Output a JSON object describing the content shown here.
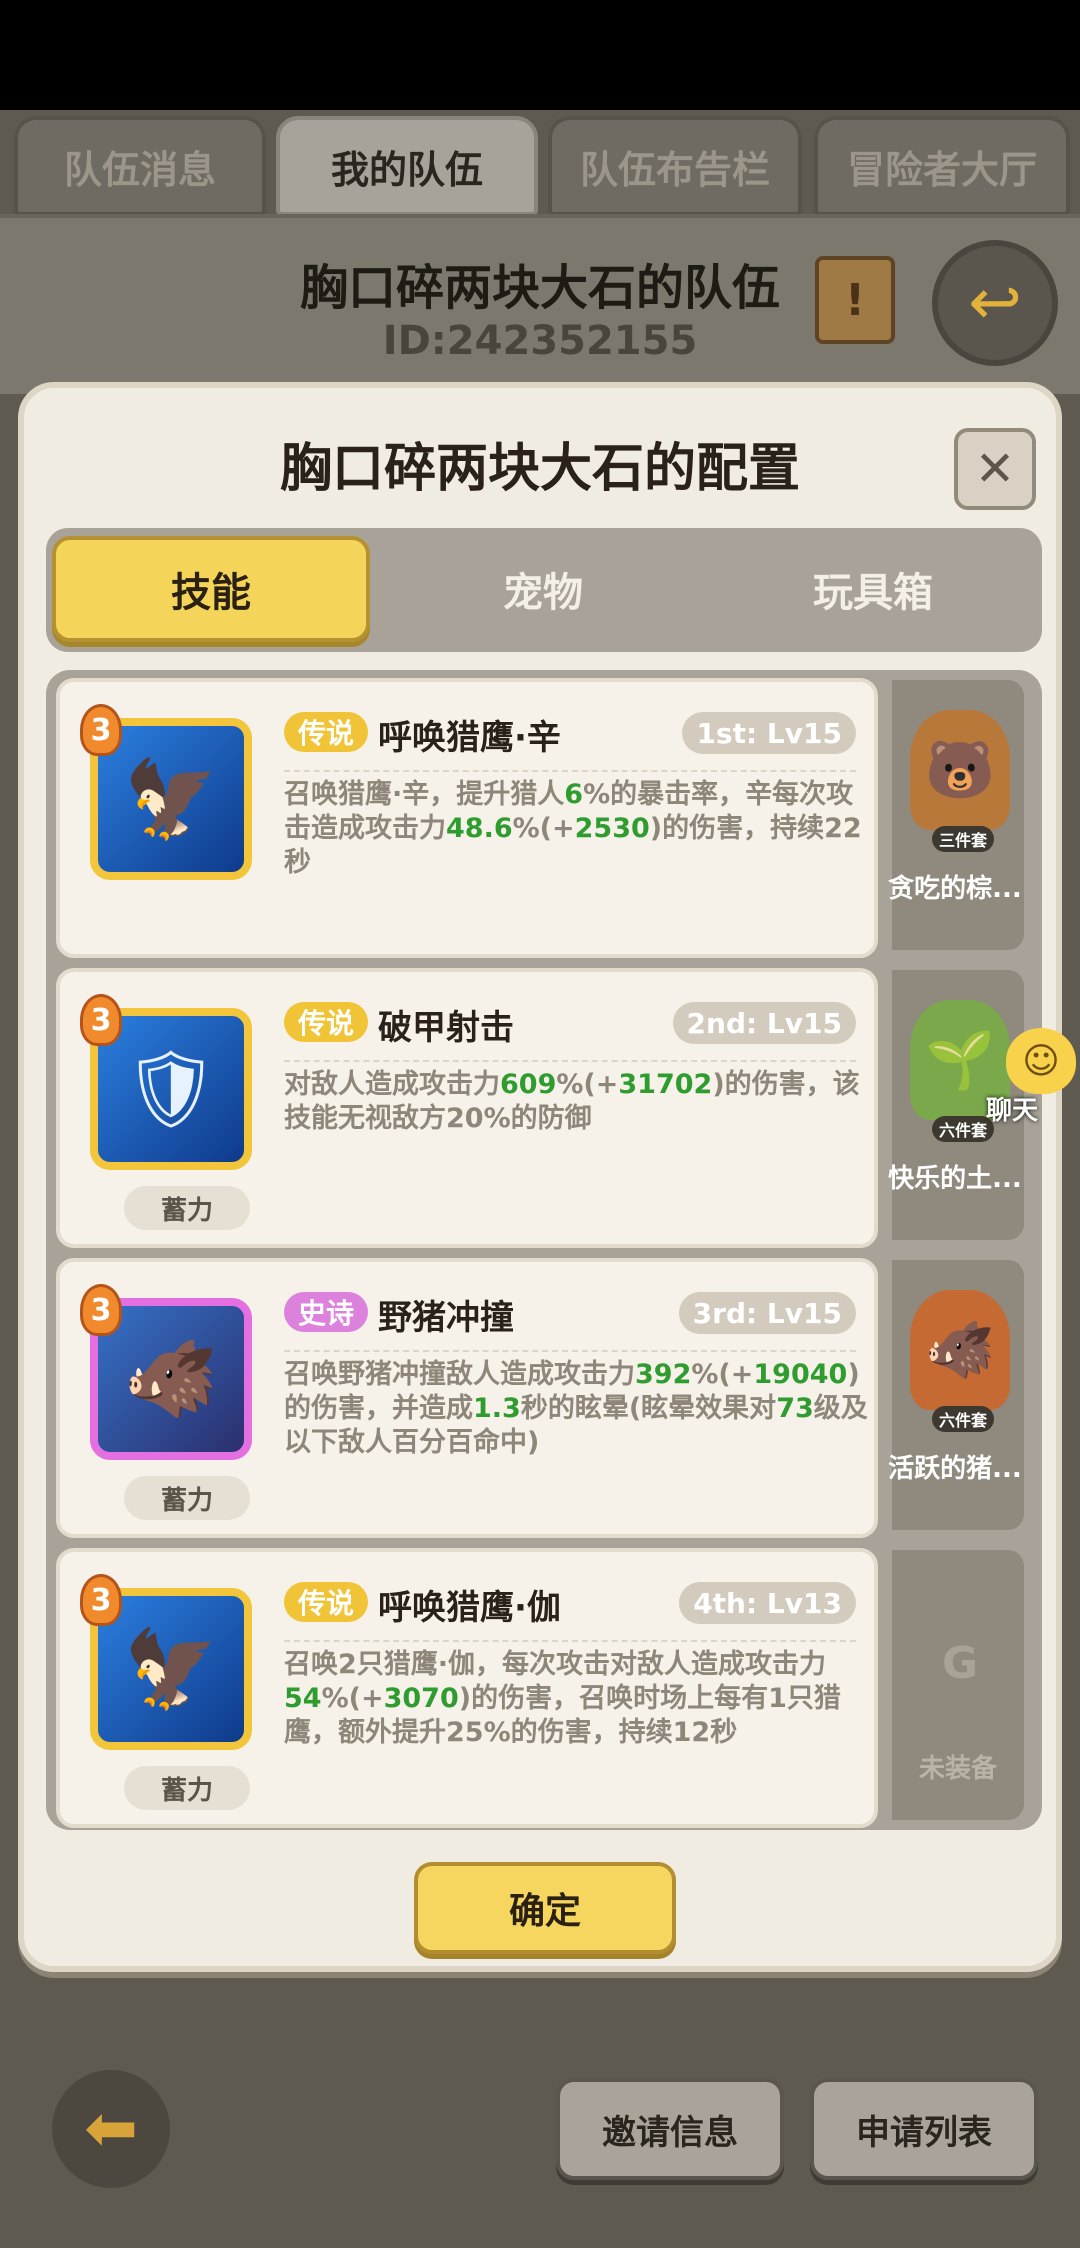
{
  "tabs": [
    {
      "label": "队伍消息",
      "active": false
    },
    {
      "label": "我的队伍",
      "active": true
    },
    {
      "label": "队伍布告栏",
      "active": false
    },
    {
      "label": "冒险者大厅",
      "active": false
    }
  ],
  "team": {
    "name": "胸口碎两块大石的队伍",
    "id": "ID:242352155"
  },
  "modal": {
    "title": "胸口碎两块大石的配置",
    "segments": [
      {
        "label": "技能",
        "active": true
      },
      {
        "label": "宠物",
        "active": false
      },
      {
        "label": "玩具箱",
        "active": false
      }
    ],
    "skills": [
      {
        "rarity": "传说",
        "name": "呼唤猎鹰·辛",
        "slot": "1st: Lv15",
        "level": "3",
        "desc": [
          "召唤猎鹰·辛，提升猎人",
          {
            "n": "6"
          },
          "%的暴击率，辛每次攻击造成攻击力",
          {
            "n": "48.6"
          },
          "%(+",
          {
            "n": "2530"
          },
          ")的伤害，持续22秒"
        ],
        "charge": ""
      },
      {
        "rarity": "传说",
        "name": "破甲射击",
        "slot": "2nd: Lv15",
        "level": "3",
        "desc": [
          "对敌人造成攻击力",
          {
            "n": "609"
          },
          "%(+",
          {
            "n": "31702"
          },
          ")的伤害，该技能无视敌方20%的防御"
        ],
        "charge": "蓄力"
      },
      {
        "rarity": "史诗",
        "name": "野猪冲撞",
        "slot": "3rd: Lv15",
        "level": "3",
        "desc": [
          "召唤野猪冲撞敌人造成攻击力",
          {
            "n": "392"
          },
          "%(+",
          {
            "n": "19040"
          },
          ")的伤害，并造成",
          {
            "n": "1.3"
          },
          "秒的眩晕(眩晕效果对",
          {
            "n": "73"
          },
          "级及以下敌人百分百命中)"
        ],
        "charge": "蓄力"
      },
      {
        "rarity": "传说",
        "name": "呼唤猎鹰·伽",
        "slot": "4th: Lv13",
        "level": "3",
        "desc": [
          "召唤2只猎鹰·伽，每次攻击对敌人造成攻击力",
          {
            "n": "54"
          },
          "%(+",
          {
            "n": "3070"
          },
          ")的伤害，召唤时场上每有1只猎鹰，额外提升25%的伤害，持续12秒"
        ],
        "charge": "蓄力"
      }
    ],
    "pets": [
      {
        "set": "三件套",
        "name": "贪吃的棕...",
        "icon": "bear-pet-icon"
      },
      {
        "set": "六件套",
        "name": "快乐的土...",
        "icon": "plant-pet-icon"
      },
      {
        "set": "六件套",
        "name": "活跃的猪...",
        "icon": "boar-pet-icon"
      },
      {
        "set": "",
        "name": "未装备",
        "icon": "empty-slot-icon"
      }
    ],
    "confirm_label": "确定"
  },
  "chat": {
    "label": "聊天"
  },
  "bottom": {
    "invite_label": "邀请信息",
    "apply_label": "申请列表"
  },
  "colors": {
    "accent": "#f4d55a",
    "legend": "#f1c437",
    "epic": "#dd82dc",
    "number": "#2f9c2f"
  }
}
